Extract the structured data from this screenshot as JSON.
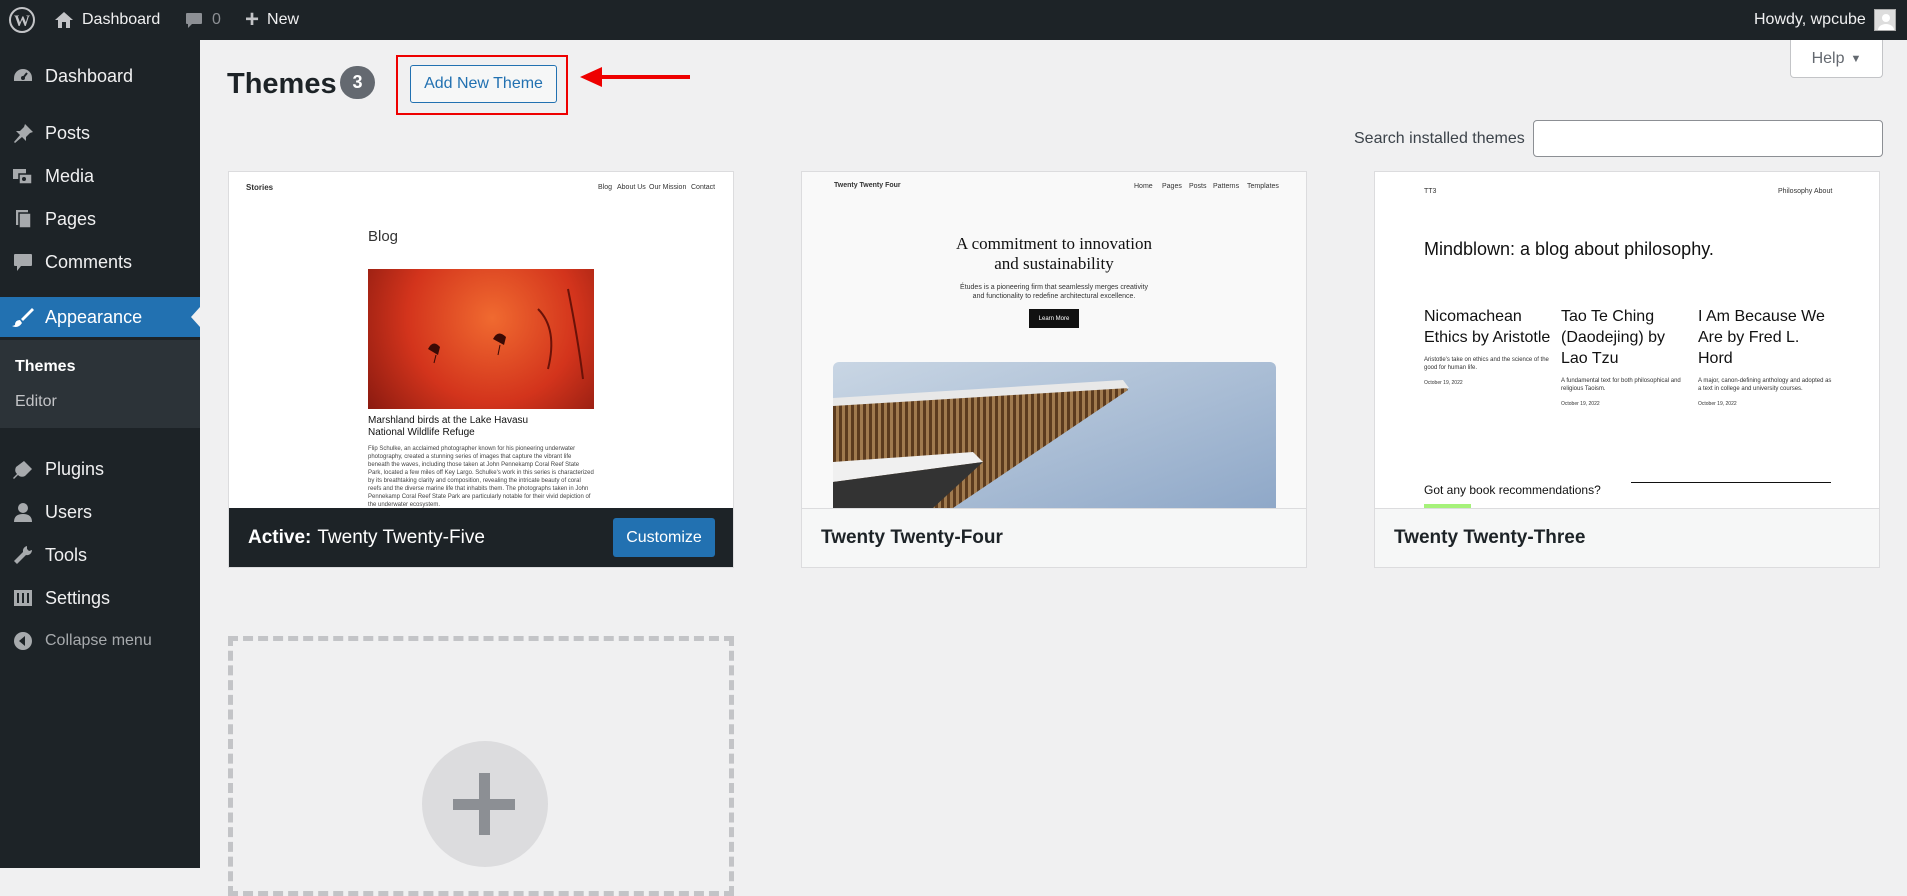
{
  "adminbar": {
    "site_link": "Dashboard",
    "comments_count": "0",
    "new_label": "New",
    "howdy": "Howdy, wpcube"
  },
  "sidebar": {
    "items": [
      {
        "label": "Dashboard"
      },
      {
        "label": "Posts"
      },
      {
        "label": "Media"
      },
      {
        "label": "Pages"
      },
      {
        "label": "Comments"
      },
      {
        "label": "Appearance"
      },
      {
        "label": "Plugins"
      },
      {
        "label": "Users"
      },
      {
        "label": "Tools"
      },
      {
        "label": "Settings"
      }
    ],
    "submenu": [
      "Themes",
      "Editor"
    ],
    "collapse": "Collapse menu"
  },
  "header": {
    "title": "Themes",
    "count": "3",
    "add_new": "Add New Theme",
    "help": "Help"
  },
  "search": {
    "label": "Search installed themes",
    "placeholder": ""
  },
  "themes": [
    {
      "active_prefix": "Active:",
      "name": "Twenty Twenty-Five",
      "customize": "Customize",
      "preview": {
        "site": "Stories",
        "nav": [
          "Blog",
          "About Us",
          "Our Mission",
          "Contact"
        ],
        "heading": "Blog",
        "post_title": "Marshland birds at the Lake Havasu National Wildlife Refuge",
        "excerpt": "Flip Schulke, an acclaimed photographer known for his pioneering underwater photography, created a stunning series of images that capture the vibrant life beneath the waves, including those taken at John Pennekamp Coral Reef State Park, located a few miles off Key Largo. Schulke's work in this series is characterized by its breathtaking clarity and composition, revealing the intricate beauty of coral reefs and the diverse marine life that inhabits them. The photographs taken in John Pennekamp Coral Reef State Park are particularly notable for their vivid depiction of the underwater ecosystem."
      }
    },
    {
      "name": "Twenty Twenty-Four",
      "preview": {
        "site": "Twenty Twenty Four",
        "nav": [
          "Home",
          "Pages",
          "Posts",
          "Patterns",
          "Templates"
        ],
        "heading_l1": "A commitment to innovation",
        "heading_l2": "and sustainability",
        "sub_l1": "Études is a pioneering firm that seamlessly merges creativity",
        "sub_l2": "and functionality to redefine architectural excellence.",
        "button": "Learn More"
      }
    },
    {
      "name": "Twenty Twenty-Three",
      "preview": {
        "site": "TT3",
        "nav": [
          "Philosophy",
          "About"
        ],
        "heading": "Mindblown: a blog about philosophy.",
        "posts": [
          {
            "title": "Nicomachean Ethics by Aristotle",
            "desc": "Aristotle's take on ethics and the science of the good for human life.",
            "date": "October 19, 2022"
          },
          {
            "title": "Tao Te Ching (Daodejing) by Lao Tzu",
            "desc": "A fundamental text for both philosophical and religious Taoism.",
            "date": "October 19, 2022"
          },
          {
            "title": "I Am Because We Are by Fred L. Hord",
            "desc": "A major, canon-defining anthology and adopted as a text in college and university courses.",
            "date": "October 19, 2022"
          }
        ],
        "footer_q": "Got any book recommendations?"
      }
    }
  ]
}
